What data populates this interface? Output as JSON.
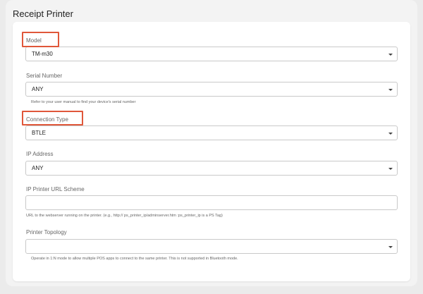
{
  "section": {
    "title": "Receipt Printer"
  },
  "fields": {
    "model": {
      "label": "Model",
      "value": "TM-m30"
    },
    "serial_number": {
      "label": "Serial Number",
      "value": "ANY",
      "helper": "Refer to your user manual to find your device's serial number"
    },
    "connection_type": {
      "label": "Connection Type",
      "value": "BTLE"
    },
    "ip_address": {
      "label": "IP Address",
      "value": "ANY"
    },
    "url_scheme": {
      "label": "IP Printer URL Scheme",
      "value": "",
      "helper": "URL to the webserver running on the printer. (e.g., http:// ps_printer_ip/adminserver.htm :ps_printer_ip is a PS Tag)"
    },
    "printer_topology": {
      "label": "Printer Topology",
      "value": "",
      "helper": "Operate in 1:N mode to allow multiple POS apps to connect to the same printer. This is not supported in Bluetooth mode."
    }
  },
  "colors": {
    "highlight": "#e0573a",
    "card": "#ffffff",
    "background": "#ebebeb"
  }
}
